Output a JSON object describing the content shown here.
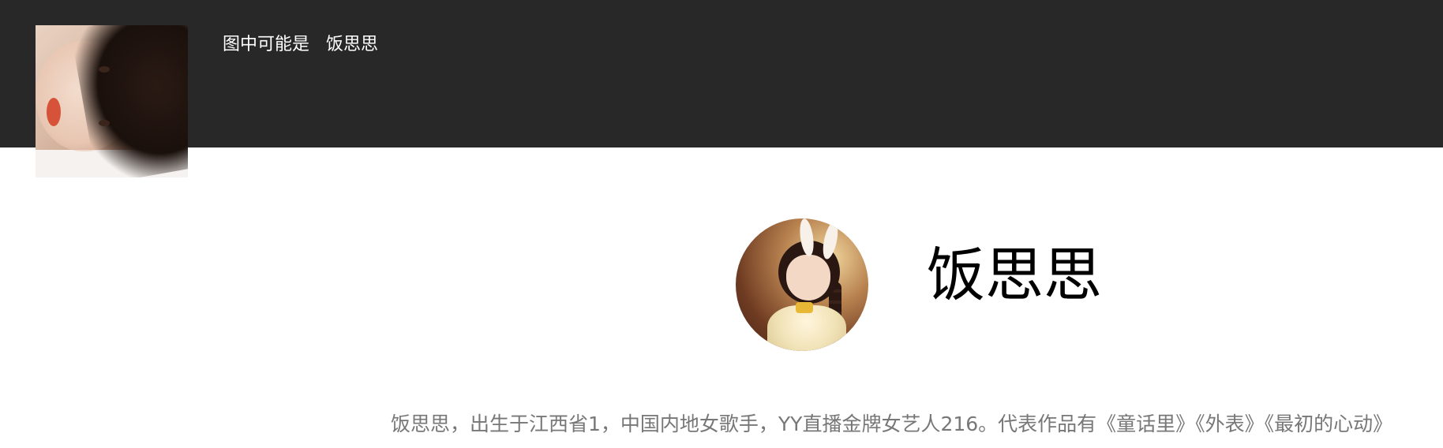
{
  "header": {
    "caption_prefix": "图中可能是",
    "caption_name": "饭思思"
  },
  "profile": {
    "name": "饭思思",
    "bio": "饭思思，出生于江西省1，中国内地女歌手，YY直播金牌女艺人216。代表作品有《童话里》《外表》《最初的心动》"
  }
}
